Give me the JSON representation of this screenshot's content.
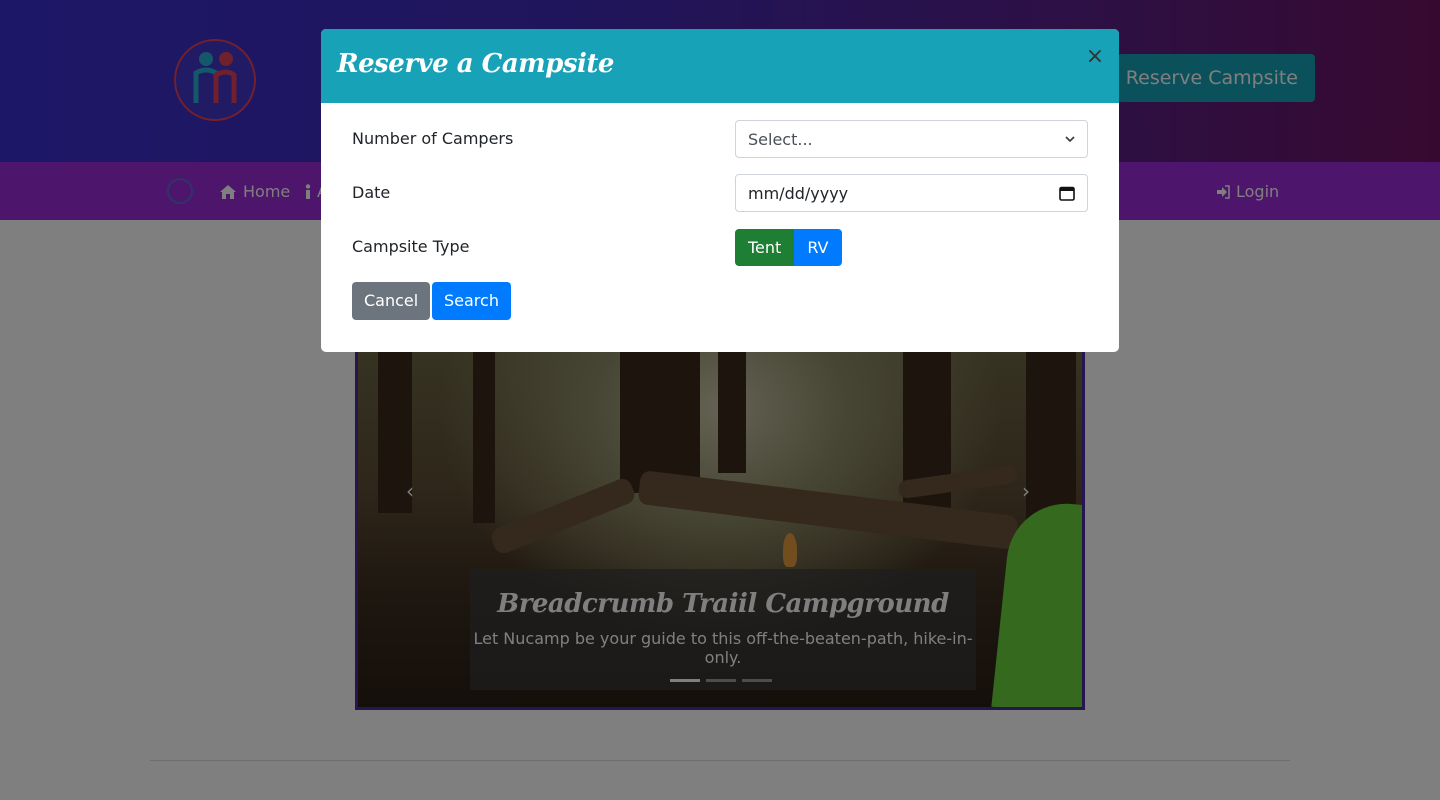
{
  "header": {
    "reserve_button": "Reserve Campsite"
  },
  "nav": {
    "items": [
      {
        "label": "Home",
        "icon": "home-icon"
      },
      {
        "label": "A",
        "icon": "info-icon"
      },
      {
        "label": "Login",
        "icon": "sign-in-icon"
      }
    ]
  },
  "carousel": {
    "caption_title": "Breadcrumb Traiil Campground",
    "caption_text": "Let Nucamp be your guide to this off-the-beaten-path, hike-in-only.",
    "prev_icon": "chevron-left-icon",
    "next_icon": "chevron-right-icon",
    "active_slide": 1,
    "slide_count": 3
  },
  "modal": {
    "title": "Reserve a Campsite",
    "close_glyph": "×",
    "campers_label": "Number of Campers",
    "campers_value": "Select...",
    "date_label": "Date",
    "date_placeholder": "mm/dd/yyyy",
    "type_label": "Campsite Type",
    "type_options": [
      "Tent",
      "RV"
    ],
    "selected_type": "Tent",
    "cancel_label": "Cancel",
    "search_label": "Search"
  },
  "colors": {
    "header_gradient_start": "#3a2fd0",
    "header_gradient_end": "#6e1360",
    "navbar": "#9a2bd8",
    "modal_header": "#17a2b8",
    "primary": "#007bff",
    "success": "#1e7e34",
    "secondary": "#6c757d"
  }
}
